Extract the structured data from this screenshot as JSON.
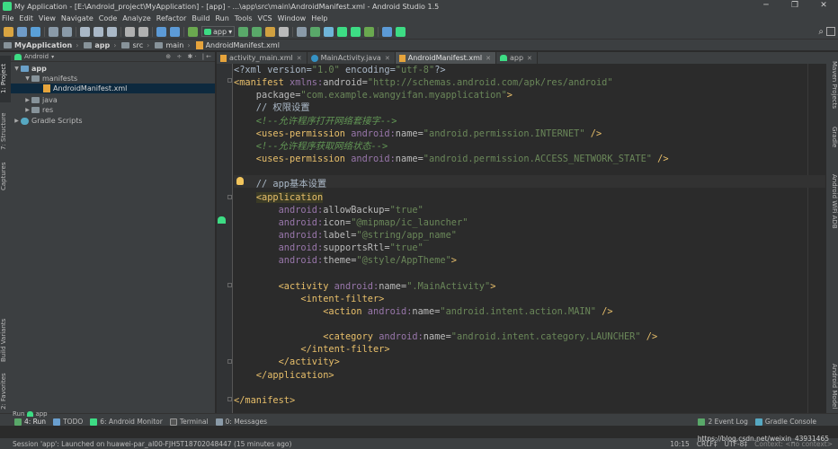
{
  "window": {
    "title": "My Application - [E:\\Android_project\\MyApplication] - [app] - ...\\app\\src\\main\\AndroidManifest.xml - Android Studio 1.5",
    "controls": [
      "─",
      "❐",
      "✕"
    ]
  },
  "menu": [
    "File",
    "Edit",
    "View",
    "Navigate",
    "Code",
    "Analyze",
    "Refactor",
    "Build",
    "Run",
    "Tools",
    "VCS",
    "Window",
    "Help"
  ],
  "toolbar": {
    "run_config": "app",
    "run_config_arrow": "▾",
    "search_icon": "⌕"
  },
  "breadcrumbs": [
    {
      "label": "MyApplication",
      "icon": "folder-icon"
    },
    {
      "label": "app",
      "icon": "folder-icon"
    },
    {
      "label": "src",
      "icon": "folder-icon"
    },
    {
      "label": "main",
      "icon": "folder-icon"
    },
    {
      "label": "AndroidManifest.xml",
      "icon": "xml-file-icon"
    }
  ],
  "project_panel": {
    "view_mode": "Android",
    "tools": "⊕ ÷ ✱· |←",
    "tree": [
      {
        "label": "app",
        "level": 0,
        "arrow": "▼",
        "type": "module",
        "bold": true
      },
      {
        "label": "manifests",
        "level": 1,
        "arrow": "▼",
        "type": "folder"
      },
      {
        "label": "AndroidManifest.xml",
        "level": 2,
        "arrow": "",
        "type": "xml",
        "selected": true
      },
      {
        "label": "java",
        "level": 1,
        "arrow": "▶",
        "type": "folder"
      },
      {
        "label": "res",
        "level": 1,
        "arrow": "▶",
        "type": "folder"
      },
      {
        "label": "Gradle Scripts",
        "level": 0,
        "arrow": "▶",
        "type": "gradle"
      }
    ]
  },
  "left_tool_tabs": [
    "1: Project",
    "7: Structure",
    "Captures",
    "Build Variants",
    "2: Favorites"
  ],
  "right_tool_tabs": [
    "Maven Projects",
    "Gradle",
    "Android WiFi ADB",
    "Android Model"
  ],
  "editor_tabs": [
    {
      "label": "activity_main.xml",
      "icon": "xml",
      "active": false
    },
    {
      "label": "MainActivity.java",
      "icon": "class",
      "active": false
    },
    {
      "label": "AndroidManifest.xml",
      "icon": "xml",
      "active": true
    },
    {
      "label": "app",
      "icon": "android",
      "active": false
    }
  ],
  "code_lines": [
    [
      [
        "t-plain",
        "<?xml version="
      ],
      [
        "t-str",
        "\"1.0\""
      ],
      [
        "t-plain",
        " encoding="
      ],
      [
        "t-str",
        "\"utf-8\""
      ],
      [
        "t-plain",
        "?>"
      ]
    ],
    [
      [
        "t-tag",
        "<manifest "
      ],
      [
        "t-ns",
        "xmlns:"
      ],
      [
        "t-attr",
        "android="
      ],
      [
        "t-str",
        "\"http://schemas.android.com/apk/res/android\""
      ]
    ],
    [
      [
        "t-attr",
        "    package="
      ],
      [
        "t-str",
        "\"com.example.wangyifan.myapplication\""
      ],
      [
        "t-tag",
        ">"
      ]
    ],
    [
      [
        "t-plain",
        "    // 权限设置"
      ]
    ],
    [
      [
        "t-com",
        "    <!--允许程序打开网络套接字-->"
      ]
    ],
    [
      [
        "t-tag",
        "    <uses-permission "
      ],
      [
        "t-ns",
        "android:"
      ],
      [
        "t-attr",
        "name="
      ],
      [
        "t-str",
        "\"android.permission.INTERNET\""
      ],
      [
        "t-tag",
        " />"
      ]
    ],
    [
      [
        "t-com",
        "    <!--允许程序获取网络状态-->"
      ]
    ],
    [
      [
        "t-tag",
        "    <uses-permission "
      ],
      [
        "t-ns",
        "android:"
      ],
      [
        "t-attr",
        "name="
      ],
      [
        "t-str",
        "\"android.permission.ACCESS_NETWORK_STATE\""
      ],
      [
        "t-tag",
        " />"
      ]
    ],
    [
      [
        "t-plain",
        ""
      ]
    ],
    [
      [
        "t-plain",
        "    // app基本设置"
      ]
    ],
    [
      [
        "t-plain",
        "    "
      ],
      [
        "t-hl",
        "<application"
      ]
    ],
    [
      [
        "t-ns",
        "        android:"
      ],
      [
        "t-attr",
        "allowBackup="
      ],
      [
        "t-str",
        "\"true\""
      ]
    ],
    [
      [
        "t-ns",
        "        android:"
      ],
      [
        "t-attr",
        "icon="
      ],
      [
        "t-str",
        "\"@mipmap/ic_launcher\""
      ]
    ],
    [
      [
        "t-ns",
        "        android:"
      ],
      [
        "t-attr",
        "label="
      ],
      [
        "t-str",
        "\"@string/app_name\""
      ]
    ],
    [
      [
        "t-ns",
        "        android:"
      ],
      [
        "t-attr",
        "supportsRtl="
      ],
      [
        "t-str",
        "\"true\""
      ]
    ],
    [
      [
        "t-ns",
        "        android:"
      ],
      [
        "t-attr",
        "theme="
      ],
      [
        "t-str",
        "\"@style/AppTheme\""
      ],
      [
        "t-tag",
        ">"
      ]
    ],
    [
      [
        "t-plain",
        ""
      ]
    ],
    [
      [
        "t-tag",
        "        <activity "
      ],
      [
        "t-ns",
        "android:"
      ],
      [
        "t-attr",
        "name="
      ],
      [
        "t-str",
        "\".MainActivity\""
      ],
      [
        "t-tag",
        ">"
      ]
    ],
    [
      [
        "t-tag",
        "            <intent-filter>"
      ]
    ],
    [
      [
        "t-tag",
        "                <action "
      ],
      [
        "t-ns",
        "android:"
      ],
      [
        "t-attr",
        "name="
      ],
      [
        "t-str",
        "\"android.intent.action.MAIN\""
      ],
      [
        "t-tag",
        " />"
      ]
    ],
    [
      [
        "t-plain",
        ""
      ]
    ],
    [
      [
        "t-tag",
        "                <category "
      ],
      [
        "t-ns",
        "android:"
      ],
      [
        "t-attr",
        "name="
      ],
      [
        "t-str",
        "\"android.intent.category.LAUNCHER\""
      ],
      [
        "t-tag",
        " />"
      ]
    ],
    [
      [
        "t-tag",
        "            </intent-filter>"
      ]
    ],
    [
      [
        "t-tag",
        "        </activity>"
      ]
    ],
    [
      [
        "t-tag",
        "    </application>"
      ]
    ],
    [
      [
        "t-plain",
        ""
      ]
    ],
    [
      [
        "t-tag",
        "</manifest>"
      ]
    ]
  ],
  "bottom_panel": {
    "run_header": "Run",
    "run_config": "app",
    "tabs": [
      {
        "label": "4: Run",
        "icon": "run-icon"
      },
      {
        "label": "TODO",
        "icon": "todo-icon"
      },
      {
        "label": "6: Android Monitor",
        "icon": "android-monitor-icon"
      },
      {
        "label": "Terminal",
        "icon": "terminal-icon"
      },
      {
        "label": "0: Messages",
        "icon": "messages-icon"
      }
    ],
    "right_tabs": [
      {
        "label": "2 Event Log",
        "icon": "event-log-icon"
      },
      {
        "label": "Gradle Console",
        "icon": "gradle-console-icon"
      }
    ]
  },
  "status": {
    "message": "Session 'app': Launched on huawei-par_al00-FJH5T18702048447 (15 minutes ago)",
    "position": "10:15",
    "line_sep": "CRLF‡",
    "encoding": "UTF-8‡",
    "context": "Context: <no context>"
  },
  "watermark": "https://blog.csdn.net/weixin_43931465",
  "colors": {
    "tag": "#e8bf6a",
    "attr": "#bababa",
    "namespace": "#9876aa",
    "string": "#6a8759",
    "comment": "#629755",
    "background": "#2b2b2b",
    "panel": "#3c3f41",
    "selection": "#0d293e"
  }
}
